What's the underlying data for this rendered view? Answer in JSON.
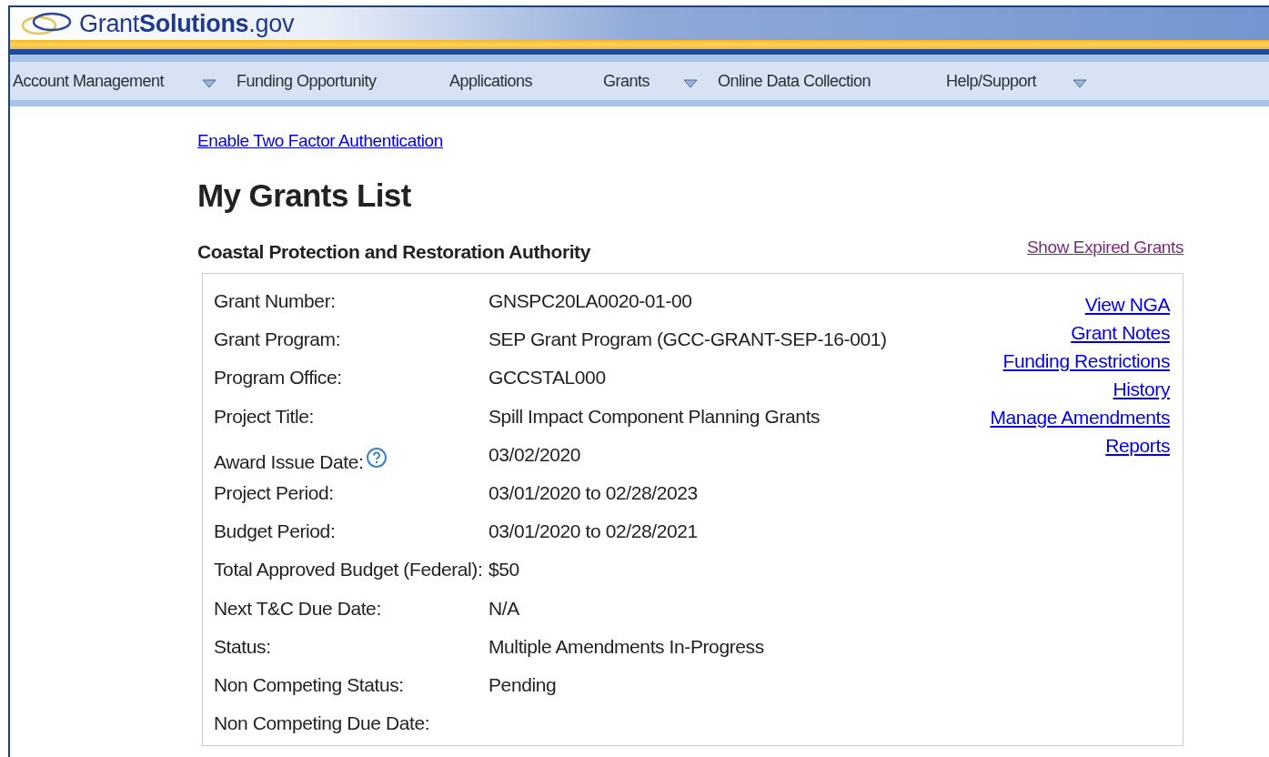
{
  "logo": {
    "text": "Grant**Solutions**.gov"
  },
  "nav": [
    {
      "label": "Account Management",
      "dropdown": true
    },
    {
      "label": "Funding Opportunity",
      "dropdown": false
    },
    {
      "label": "Applications",
      "dropdown": false
    },
    {
      "label": "Grants",
      "dropdown": true
    },
    {
      "label": "Online Data Collection",
      "dropdown": false
    },
    {
      "label": "Help/Support",
      "dropdown": true
    }
  ],
  "two_factor_link": "Enable Two Factor Authentication",
  "page_title": "My Grants List",
  "organization": "Coastal Protection and Restoration Authority",
  "show_expired_link": "Show Expired Grants",
  "grant": {
    "fields": [
      {
        "label": "Grant Number:",
        "value": "GNSPC20LA0020-01-00",
        "help": false
      },
      {
        "label": "Grant Program:",
        "value": "SEP Grant Program (GCC-GRANT-SEP-16-001)",
        "help": false
      },
      {
        "label": "Program Office:",
        "value": "GCCSTAL000",
        "help": false
      },
      {
        "label": "Project Title:",
        "value": "Spill Impact Component Planning Grants",
        "help": false
      },
      {
        "label": "Award Issue Date:",
        "value": "03/02/2020",
        "help": true
      },
      {
        "label": "Project Period:",
        "value": "03/01/2020 to 02/28/2023",
        "help": false
      },
      {
        "label": "Budget Period:",
        "value": "03/01/2020 to 02/28/2021",
        "help": false
      },
      {
        "label": "Total Approved Budget (Federal):",
        "value": "$50",
        "help": false
      },
      {
        "label": "Next T&C Due Date:",
        "value": "N/A",
        "help": false
      },
      {
        "label": "Status:",
        "value": "Multiple Amendments In-Progress",
        "help": false
      },
      {
        "label": "Non Competing Status:",
        "value": "Pending",
        "help": false
      },
      {
        "label": "Non Competing Due Date:",
        "help": false
      }
    ],
    "actions": [
      "View NGA",
      "Grant Notes",
      "Funding Restrictions",
      "History",
      "Manage Amendments",
      "Reports"
    ]
  }
}
